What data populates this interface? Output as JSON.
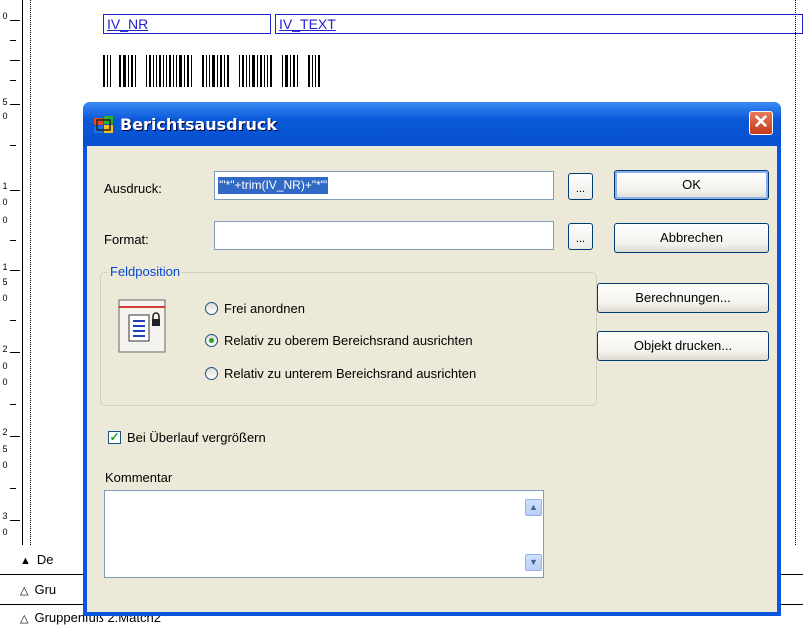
{
  "background": {
    "fields": [
      "IV_NR",
      "IV_TEXT"
    ],
    "ruler_numbers": [
      "0",
      "5",
      "0",
      "1",
      "0",
      "0",
      "1",
      "5",
      "0",
      "2",
      "0",
      "0",
      "2",
      "5",
      "0",
      "3",
      "0"
    ],
    "bands": [
      "De",
      "Gru",
      "Gruppenfuß 2:Match2"
    ]
  },
  "dialog": {
    "title": "Berichtsausdruck",
    "close_symbol": "✕",
    "expression": {
      "label": "Ausdruck:",
      "value": "'\"*\"+trim(IV_NR)+\"*\"'"
    },
    "format": {
      "label": "Format:",
      "value": ""
    },
    "ellipsis_label": "...",
    "buttons": {
      "ok": "OK",
      "cancel": "Abbrechen",
      "calculations": "Berechnungen...",
      "print_object": "Objekt drucken..."
    },
    "field_position": {
      "title": "Feldposition",
      "options": [
        {
          "label": "Frei anordnen",
          "selected": false
        },
        {
          "label": "Relativ zu oberem Bereichsrand ausrichten",
          "selected": true
        },
        {
          "label": "Relativ zu unterem Bereichsrand ausrichten",
          "selected": false
        }
      ]
    },
    "grow_on_overflow": {
      "label": "Bei Überlauf vergrößern",
      "checked": true
    },
    "comment": {
      "label": "Kommentar",
      "value": ""
    }
  }
}
